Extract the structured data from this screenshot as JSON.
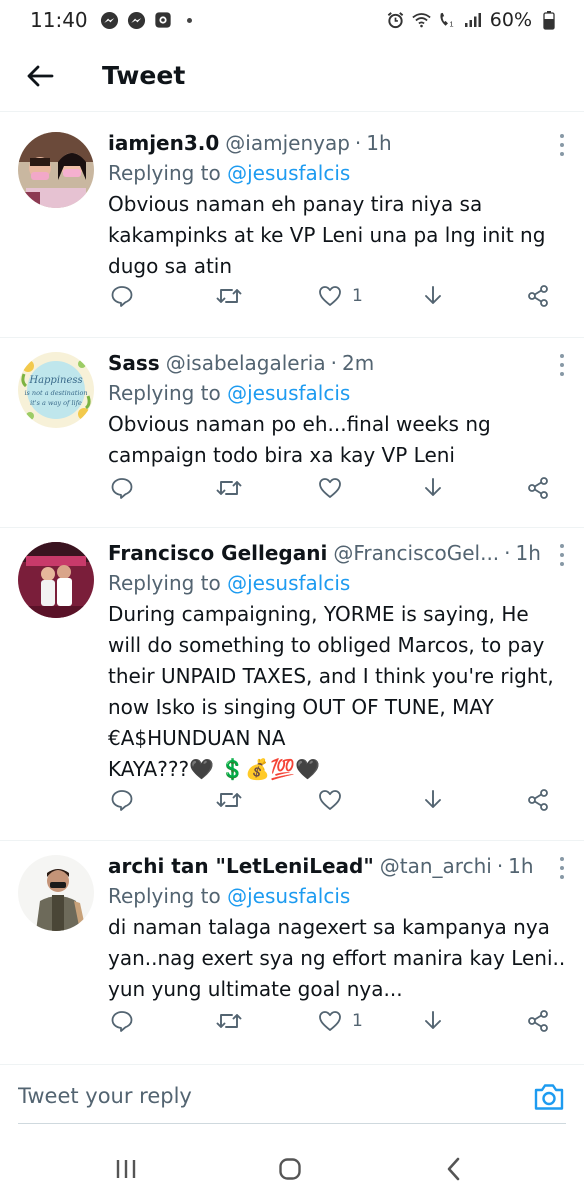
{
  "status_bar": {
    "time": "11:40",
    "battery": "60%",
    "icons": [
      "messenger-icon",
      "messenger-icon",
      "notification-icon",
      "alarm-icon",
      "wifi-icon",
      "wifi-calling-icon",
      "signal-icon",
      "battery-icon"
    ]
  },
  "header": {
    "title": "Tweet",
    "back_icon": "back-arrow-icon"
  },
  "tweets": [
    {
      "display_name": "iamjen3.0",
      "handle": "@iamjenyap",
      "time": "1h",
      "replying_label": "Replying to",
      "replying_to": "@jesusfalcis",
      "text_lines": [
        "Obvious naman eh panay tira niya sa",
        "kakampinks at ke VP Leni una pa lng init ng",
        "dugo sa atin"
      ],
      "like_count": "1"
    },
    {
      "display_name": "Sass",
      "handle": "@isabelagaleria",
      "time": "2m",
      "replying_label": "Replying to",
      "replying_to": "@jesusfalcis",
      "text_lines": [
        "Obvious naman po eh...final weeks ng",
        "campaign todo bira xa kay VP Leni"
      ],
      "like_count": ""
    },
    {
      "display_name": "Francisco Gellegani",
      "handle": "@FranciscoGel...",
      "time": "1h",
      "replying_label": "Replying to",
      "replying_to": "@jesusfalcis",
      "text_lines": [
        "During campaigning, YORME is saying, He",
        "will do something to obliged Marcos, to pay",
        "their UNPAID TAXES, and I think you're right,",
        "now Isko is singing OUT OF TUNE, MAY",
        "€A$HUNDUAN NA",
        "KAYA???🖤 💲💰💯🖤"
      ],
      "like_count": ""
    },
    {
      "display_name": "archi tan \"LetLeniLead\"",
      "handle": "@tan_archi",
      "time": "1h",
      "replying_label": "Replying to",
      "replying_to": "@jesusfalcis",
      "text_lines": [
        "di naman talaga nagexert sa kampanya nya",
        "yan..nag exert sya ng effort manira kay Leni..",
        "yun yung ultimate goal nya..."
      ],
      "like_count": "1"
    }
  ],
  "reply_bar": {
    "placeholder": "Tweet your reply",
    "camera_icon": "camera-icon"
  },
  "nav_bar": {
    "buttons": [
      "recents-icon",
      "home-icon",
      "back-icon"
    ]
  },
  "colors": {
    "accent": "#1d9bf0",
    "secondary_text": "#536471",
    "primary_text": "#0f1419",
    "divider": "#eff3f4"
  }
}
